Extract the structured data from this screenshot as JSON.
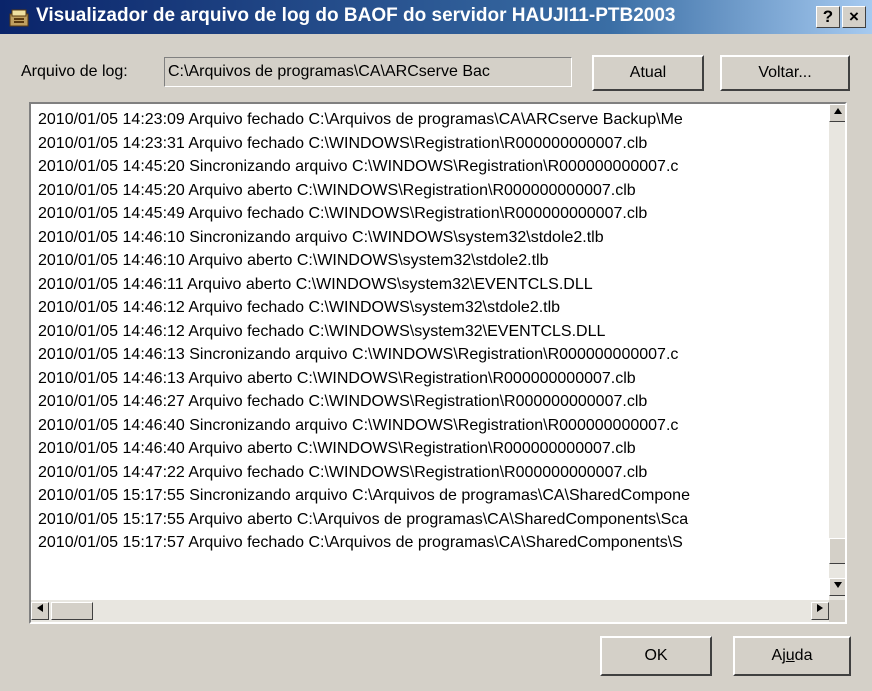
{
  "window": {
    "title": "Visualizador de arquivo de log do BAOF do servidor HAUJI11-PTB2003",
    "help_button": "?",
    "close_button": "×"
  },
  "toolbar": {
    "path_label": "Arquivo de log:",
    "path_value": "C:\\Arquivos de programas\\CA\\ARCserve Bac",
    "refresh_button": "Atual",
    "back_button": "Voltar..."
  },
  "log": {
    "lines": [
      "2010/01/05 14:23:09 Arquivo fechado C:\\Arquivos de programas\\CA\\ARCserve Backup\\Me",
      "2010/01/05 14:23:31 Arquivo fechado C:\\WINDOWS\\Registration\\R000000000007.clb",
      "2010/01/05 14:45:20 Sincronizando arquivo C:\\WINDOWS\\Registration\\R000000000007.c",
      "2010/01/05 14:45:20 Arquivo aberto C:\\WINDOWS\\Registration\\R000000000007.clb",
      "2010/01/05 14:45:49 Arquivo fechado C:\\WINDOWS\\Registration\\R000000000007.clb",
      "2010/01/05 14:46:10 Sincronizando arquivo C:\\WINDOWS\\system32\\stdole2.tlb",
      "2010/01/05 14:46:10 Arquivo aberto C:\\WINDOWS\\system32\\stdole2.tlb",
      "2010/01/05 14:46:11 Arquivo aberto C:\\WINDOWS\\system32\\EVENTCLS.DLL",
      "2010/01/05 14:46:12 Arquivo fechado C:\\WINDOWS\\system32\\stdole2.tlb",
      "2010/01/05 14:46:12 Arquivo fechado C:\\WINDOWS\\system32\\EVENTCLS.DLL",
      "2010/01/05 14:46:13 Sincronizando arquivo C:\\WINDOWS\\Registration\\R000000000007.c",
      "2010/01/05 14:46:13 Arquivo aberto C:\\WINDOWS\\Registration\\R000000000007.clb",
      "2010/01/05 14:46:27 Arquivo fechado C:\\WINDOWS\\Registration\\R000000000007.clb",
      "2010/01/05 14:46:40 Sincronizando arquivo C:\\WINDOWS\\Registration\\R000000000007.c",
      "2010/01/05 14:46:40 Arquivo aberto C:\\WINDOWS\\Registration\\R000000000007.clb",
      "2010/01/05 14:47:22 Arquivo fechado C:\\WINDOWS\\Registration\\R000000000007.clb",
      "2010/01/05 15:17:55 Sincronizando arquivo C:\\Arquivos de programas\\CA\\SharedCompone",
      "2010/01/05 15:17:55 Arquivo aberto C:\\Arquivos de programas\\CA\\SharedComponents\\Sca",
      "2010/01/05 15:17:57 Arquivo fechado C:\\Arquivos de programas\\CA\\SharedComponents\\S"
    ]
  },
  "footer": {
    "ok_button": "OK",
    "help_button_prefix": "Aj",
    "help_button_mnemonic": "u",
    "help_button_suffix": "da"
  },
  "colors": {
    "titlebar_start": "#0a246a",
    "titlebar_end": "#a6caf0",
    "dialog_face": "#d4d0c8"
  }
}
